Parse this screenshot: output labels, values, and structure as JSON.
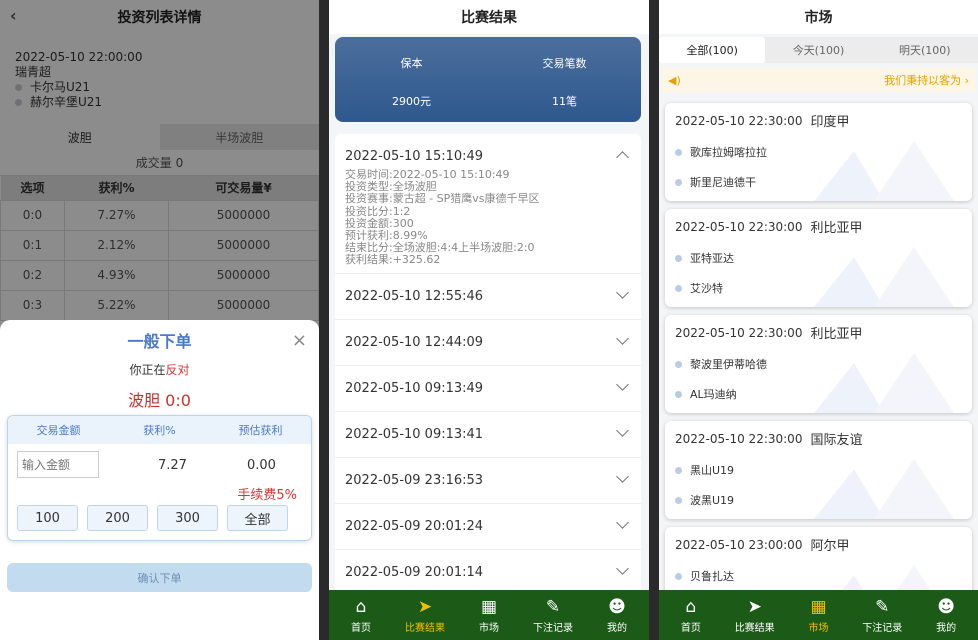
{
  "panel1": {
    "title": "投资列表详情",
    "datetime": "2022-05-10 22:00:00",
    "league": "瑞青超",
    "home": "卡尔马U21",
    "away": "赫尔辛堡U21",
    "tabs": [
      "波胆",
      "半场波胆"
    ],
    "volume": "成交量 0",
    "columns": [
      "选项",
      "获利%",
      "可交易量¥"
    ],
    "rows": [
      [
        "0:0",
        "7.27%",
        "5000000"
      ],
      [
        "0:1",
        "2.12%",
        "5000000"
      ],
      [
        "0:2",
        "4.93%",
        "5000000"
      ],
      [
        "0:3",
        "5.22%",
        "5000000"
      ]
    ],
    "sheet": {
      "title": "一般下单",
      "close": "×",
      "against_prefix": "你正在",
      "against_word": "反对",
      "pick": "波胆 0:0",
      "cols": [
        "交易金额",
        "获利%",
        "预估获利"
      ],
      "amount_placeholder": "输入金额",
      "rate": "7.27",
      "estimate": "0.00",
      "fee": "手续费5%",
      "quick": [
        "100",
        "200",
        "300",
        "全部"
      ],
      "confirm": "确认下单"
    }
  },
  "panel2": {
    "title": "比赛结果",
    "summary": [
      {
        "label": "保本",
        "value": "2900元"
      },
      {
        "label": "交易笔数",
        "value": "11笔"
      }
    ],
    "expanded": {
      "time": "2022-05-10 15:10:49",
      "lines": [
        "交易时间:2022-05-10 15:10:49",
        "投资类型:全场波胆",
        "投资赛事:蒙古超 - SP猎鹰vs康德千早区",
        "投资比分:1:2",
        "投资金额:300",
        "预计获利:8.99%",
        "结束比分:全场波胆:4:4上半场波胆:2:0",
        "获利结果:+325.62"
      ]
    },
    "records": [
      "2022-05-10 12:55:46",
      "2022-05-10 12:44:09",
      "2022-05-10 09:13:49",
      "2022-05-10 09:13:41",
      "2022-05-09 23:16:53",
      "2022-05-09 20:01:24",
      "2022-05-09 20:01:14"
    ]
  },
  "nav": [
    {
      "label": "首页",
      "icon": "home-icon",
      "glyph": "⌂"
    },
    {
      "label": "比赛结果",
      "icon": "send-icon",
      "glyph": "➤"
    },
    {
      "label": "市场",
      "icon": "market-icon",
      "glyph": "▦"
    },
    {
      "label": "下注记录",
      "icon": "record-icon",
      "glyph": "✎"
    },
    {
      "label": "我的",
      "icon": "profile-icon",
      "glyph": "☻"
    }
  ],
  "panel3": {
    "title": "市场",
    "tabs": [
      "全部(100)",
      "今天(100)",
      "明天(100)"
    ],
    "notice": "我们秉持以客为 ›",
    "cards": [
      {
        "time": "2022-05-10 22:30:00",
        "league": "印度甲",
        "home": "歌库拉姆喀拉拉",
        "away": "斯里尼迪德干"
      },
      {
        "time": "2022-05-10 22:30:00",
        "league": "利比亚甲",
        "home": "亚特亚达",
        "away": "艾沙特"
      },
      {
        "time": "2022-05-10 22:30:00",
        "league": "利比亚甲",
        "home": "黎波里伊蒂哈德",
        "away": "AL玛迪纳"
      },
      {
        "time": "2022-05-10 22:30:00",
        "league": "国际友谊",
        "home": "黑山U19",
        "away": "波黑U19"
      },
      {
        "time": "2022-05-10 23:00:00",
        "league": "阿尔甲",
        "home": "贝鲁扎达",
        "away": ""
      }
    ]
  },
  "colors": {
    "nav_bg": "#1b5b17",
    "nav_active": "#f0c000",
    "accent_red": "#c9302c",
    "summary": "#3a6296"
  }
}
